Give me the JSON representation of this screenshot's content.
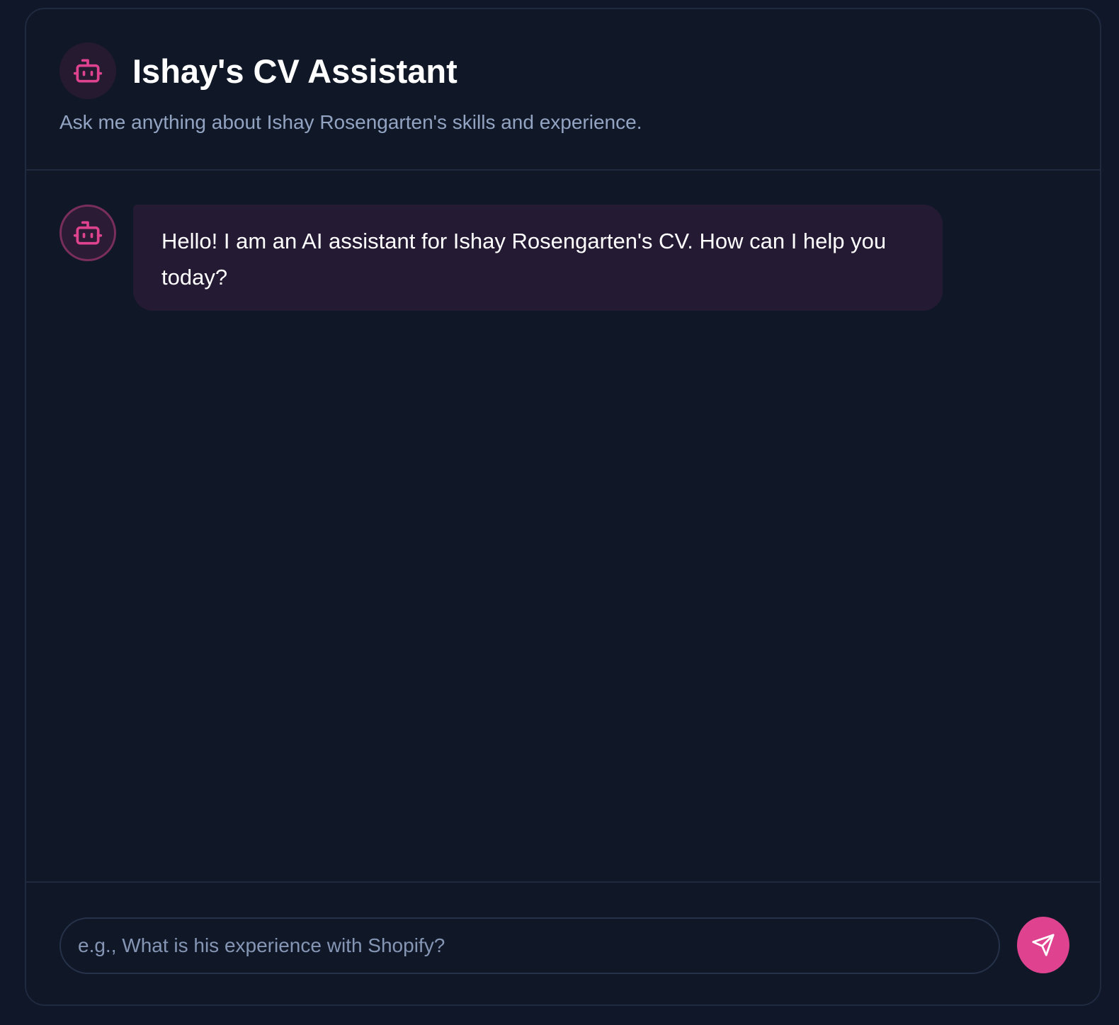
{
  "colors": {
    "page_background": "#0f1729",
    "card_background": "#101828",
    "border": "#1f2a40",
    "accent": "#df4390",
    "bubble_background": "#251a33",
    "subtitle_text": "#93a3c2"
  },
  "header": {
    "icon": "bot-icon",
    "title": "Ishay's CV Assistant",
    "subtitle": "Ask me anything about Ishay Rosengarten's skills and experience."
  },
  "messages": [
    {
      "sender": "assistant",
      "icon": "bot-icon",
      "text": "Hello! I am an AI assistant for Ishay Rosengarten's CV. How can I help you today?"
    }
  ],
  "composer": {
    "placeholder": "e.g., What is his experience with Shopify?",
    "value": "",
    "send_icon": "send-icon"
  }
}
